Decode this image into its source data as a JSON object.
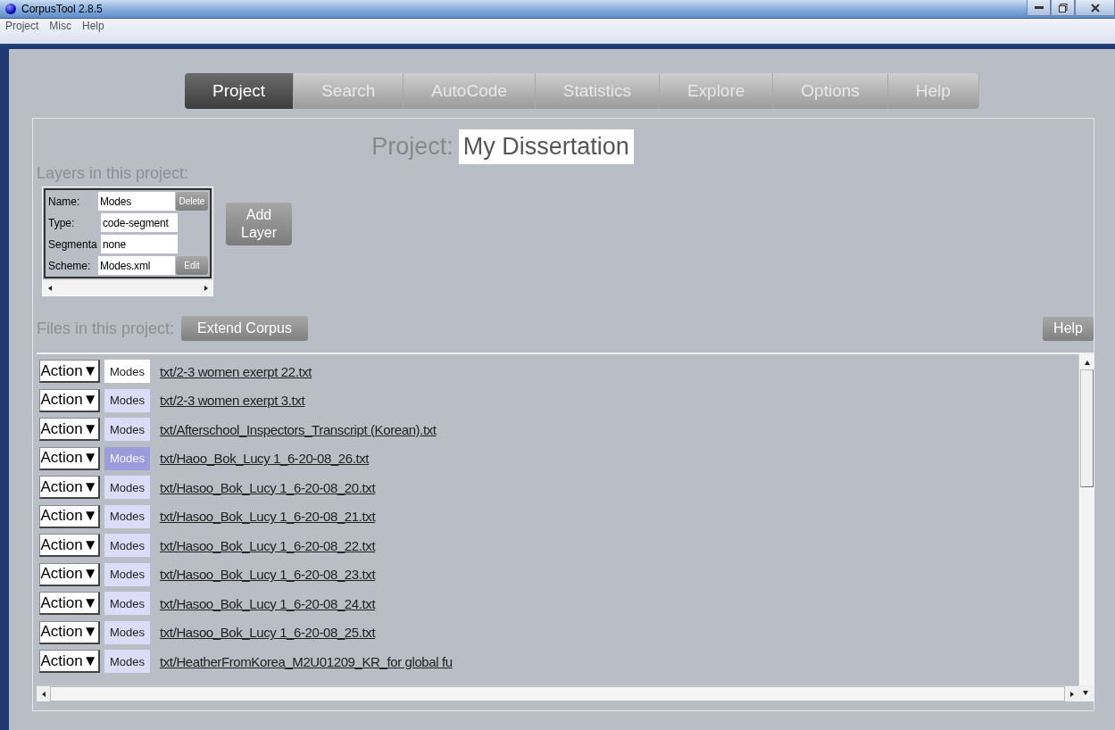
{
  "window": {
    "title": "CorpusTool 2.8.5"
  },
  "menu": [
    "Project",
    "Misc",
    "Help"
  ],
  "tabs": [
    {
      "label": "Project",
      "selected": true
    },
    {
      "label": "Search",
      "selected": false
    },
    {
      "label": "AutoCode",
      "selected": false
    },
    {
      "label": "Statistics",
      "selected": false
    },
    {
      "label": "Explore",
      "selected": false
    },
    {
      "label": "Options",
      "selected": false
    },
    {
      "label": "Help",
      "selected": false
    }
  ],
  "project": {
    "label": "Project:",
    "name": "My Dissertation"
  },
  "layers": {
    "heading": "Layers in this project:",
    "fields": [
      {
        "label": "Name:",
        "value": "Modes",
        "button": "Delete"
      },
      {
        "label": "Type:",
        "value": "code-segment"
      },
      {
        "label": "Segmenta",
        "value": "none"
      },
      {
        "label": "Scheme:",
        "value": "Modes.xml",
        "button": "Edit"
      }
    ],
    "add_button": "Add Layer"
  },
  "files": {
    "heading": "Files in this project:",
    "extend_button": "Extend Corpus",
    "help_button": "Help",
    "rows": [
      {
        "action": "Action▼",
        "layer": "Modes",
        "selected": true,
        "highlighted": false,
        "file": "txt/2-3 women exerpt 22.txt"
      },
      {
        "action": "Action▼",
        "layer": "Modes",
        "selected": false,
        "highlighted": false,
        "file": "txt/2-3 women exerpt 3.txt"
      },
      {
        "action": "Action▼",
        "layer": "Modes",
        "selected": false,
        "highlighted": false,
        "file": "txt/Afterschool_Inspectors_Transcript (Korean).txt"
      },
      {
        "action": "Action▼",
        "layer": "Modes",
        "selected": false,
        "highlighted": true,
        "file": "txt/Haoo_Bok_Lucy 1_6-20-08_26.txt"
      },
      {
        "action": "Action▼",
        "layer": "Modes",
        "selected": false,
        "highlighted": false,
        "file": "txt/Hasoo_Bok_Lucy 1_6-20-08_20.txt"
      },
      {
        "action": "Action▼",
        "layer": "Modes",
        "selected": false,
        "highlighted": false,
        "file": "txt/Hasoo_Bok_Lucy 1_6-20-08_21.txt"
      },
      {
        "action": "Action▼",
        "layer": "Modes",
        "selected": false,
        "highlighted": false,
        "file": "txt/Hasoo_Bok_Lucy 1_6-20-08_22.txt"
      },
      {
        "action": "Action▼",
        "layer": "Modes",
        "selected": false,
        "highlighted": false,
        "file": "txt/Hasoo_Bok_Lucy 1_6-20-08_23.txt"
      },
      {
        "action": "Action▼",
        "layer": "Modes",
        "selected": false,
        "highlighted": false,
        "file": "txt/Hasoo_Bok_Lucy 1_6-20-08_24.txt"
      },
      {
        "action": "Action▼",
        "layer": "Modes",
        "selected": false,
        "highlighted": false,
        "file": "txt/Hasoo_Bok_Lucy 1_6-20-08_25.txt"
      },
      {
        "action": "Action▼",
        "layer": "Modes",
        "selected": false,
        "highlighted": false,
        "file": "txt/HeatherFromKorea_M2U01209_KR_for global fu"
      }
    ]
  }
}
